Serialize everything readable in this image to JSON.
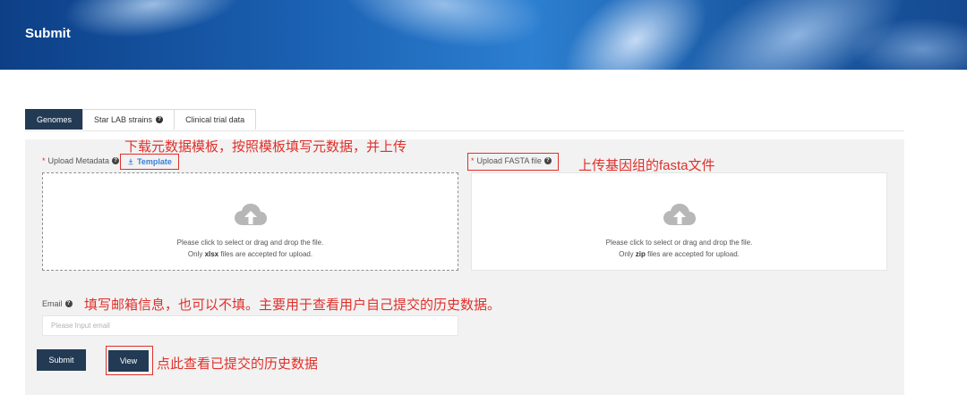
{
  "page": {
    "title": "Submit"
  },
  "tabs": [
    {
      "label": "Genomes",
      "active": true
    },
    {
      "label": "Star LAB strains",
      "has_help_icon": true
    },
    {
      "label": "Clinical trial data"
    }
  ],
  "metadata": {
    "required_mark": "*",
    "label": "Upload Metadata",
    "template_label": "Template",
    "drop_line1": "Please click to select or drag and drop the file.",
    "drop_line2_prefix": "Only",
    "drop_line2_ext": "xlsx",
    "drop_line2_suffix": "files are accepted for upload."
  },
  "fasta": {
    "required_mark": "*",
    "label": "Upload FASTA file",
    "drop_line1": "Please click to select or drag and drop the file.",
    "drop_line2_prefix": "Only",
    "drop_line2_ext": "zip",
    "drop_line2_suffix": "files are accepted for upload."
  },
  "email": {
    "label": "Email",
    "placeholder": "Please Input email",
    "value": ""
  },
  "buttons": {
    "submit": "Submit",
    "view": "View"
  },
  "annotations": {
    "template_note": "下载元数据模板，按照模板填写元数据，并上传",
    "fasta_note": "上传基因组的fasta文件",
    "email_note": "填写邮箱信息，也可以不填。主要用于查看用户自己提交的历史数据。",
    "view_note": "点此查看已提交的历史数据"
  },
  "colors": {
    "accent": "#223a54",
    "annotation_red": "#e0302a",
    "link_blue": "#3b7fd9",
    "panel_bg": "#f2f2f2"
  },
  "icons": {
    "upload": "cloud-upload-icon",
    "help": "question-circle-icon",
    "download": "download-icon"
  }
}
